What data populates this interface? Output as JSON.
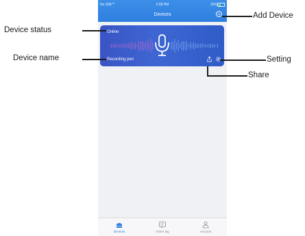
{
  "statusbar": {
    "carrier": "No SIM",
    "time": "5:58 PM",
    "battery": "30%"
  },
  "header": {
    "title": "Devices"
  },
  "device_card": {
    "status": "Online",
    "name": "Recording pen"
  },
  "tabs": [
    {
      "label": "Devices",
      "icon": "device-icon",
      "active": true
    },
    {
      "label": "Alarm log",
      "icon": "alarm-log-icon",
      "active": false
    },
    {
      "label": "Account",
      "icon": "account-icon",
      "active": false
    }
  ],
  "annotations": {
    "device_status": "Device status",
    "device_name": "Device name",
    "add_device": "Add Device",
    "setting": "Setting",
    "share": "Share"
  },
  "colors": {
    "accent": "#2f7fdf",
    "card": "#3a5bd0"
  }
}
